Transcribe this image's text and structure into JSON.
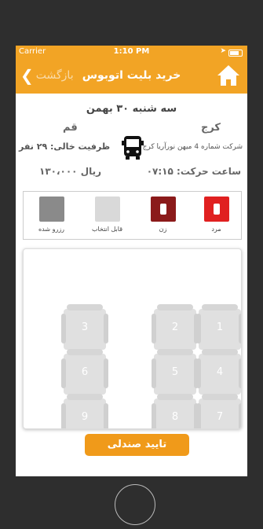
{
  "status_bar": {
    "carrier": "Carrier",
    "time": "1:10 PM"
  },
  "header": {
    "back_label": "بازگشت",
    "title": "خرید بلیت اتوبوس",
    "home_icon": "home-icon"
  },
  "trip": {
    "date": "سه شنبه ۳۰ بهمن",
    "origin": "کرج",
    "destination": "قم",
    "company": "شرکت شماره 4 میهن نورآریا کرج",
    "capacity_label": "ظرفیت خالی:",
    "capacity_value": "۲۹ نفر",
    "departure_label": "ساعت حرکت:",
    "departure_time": "۰۷:۱۵",
    "price": "۱۳۰،۰۰۰ ریال"
  },
  "legend": [
    {
      "label": "مرد",
      "type": "male",
      "color": "#e02020"
    },
    {
      "label": "زن",
      "type": "female",
      "color": "#8b1a1a"
    },
    {
      "label": "قابل انتخاب",
      "type": "available",
      "color": "#d9d9d9"
    },
    {
      "label": "رزرو شده",
      "type": "reserved",
      "color": "#8a8a8a"
    }
  ],
  "seats": [
    {
      "number": "1"
    },
    {
      "number": "2"
    },
    {
      "number": "3"
    },
    {
      "number": "4"
    },
    {
      "number": "5"
    },
    {
      "number": "6"
    },
    {
      "number": "7"
    },
    {
      "number": "8"
    },
    {
      "number": "9"
    }
  ],
  "confirm_button": "تایید صندلی",
  "colors": {
    "accent": "#f2a425",
    "button": "#f09a1a"
  }
}
